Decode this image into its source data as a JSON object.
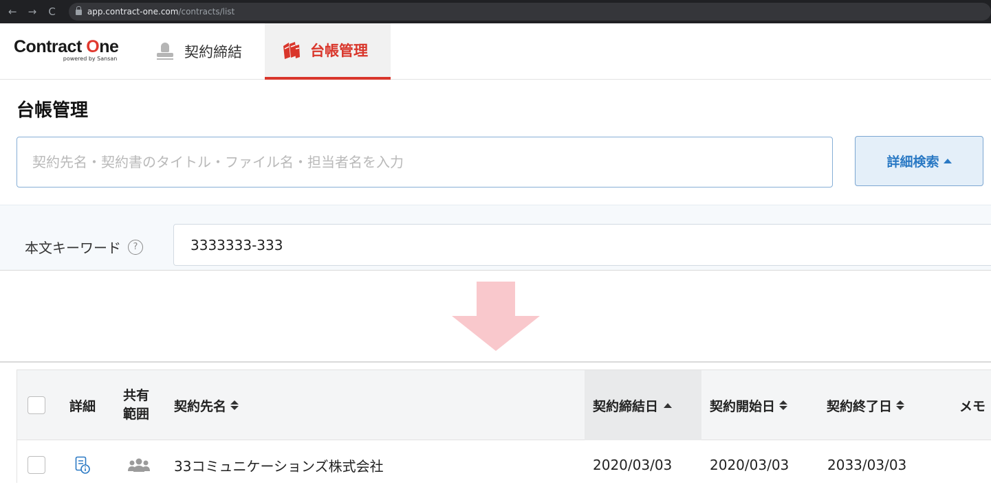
{
  "browser": {
    "back": "←",
    "forward": "→",
    "reload": "C",
    "url_host": "app.contract-one.com",
    "url_path": "/contracts/list"
  },
  "header": {
    "logo_pre": "Contract ",
    "logo_o": "O",
    "logo_post": "ne",
    "logo_sub": "powered by Sansan",
    "tabs": [
      {
        "label": "契約締結",
        "icon": "stamp-icon",
        "active": false
      },
      {
        "label": "台帳管理",
        "icon": "books-icon",
        "active": true
      }
    ],
    "accent_color": "#d9362b"
  },
  "page": {
    "title": "台帳管理"
  },
  "search": {
    "placeholder": "契約先名・契約書のタイトル・ファイル名・担当者名を入力",
    "value": "",
    "detail_button": "詳細検索"
  },
  "keyword": {
    "label": "本文キーワード",
    "help": "?",
    "value": "3333333-333"
  },
  "table": {
    "headers": {
      "detail": "詳細",
      "share_line1": "共有",
      "share_line2": "範囲",
      "partner": "契約先名",
      "signed": "契約締結日",
      "start": "契約開始日",
      "end": "契約終了日",
      "memo": "メモ"
    },
    "sorted_column": "契約締結日",
    "rows": [
      {
        "partner": "33コミュニケーションズ株式会社",
        "signed": "2020/03/03",
        "start": "2020/03/03",
        "end": "2033/03/03"
      }
    ]
  }
}
